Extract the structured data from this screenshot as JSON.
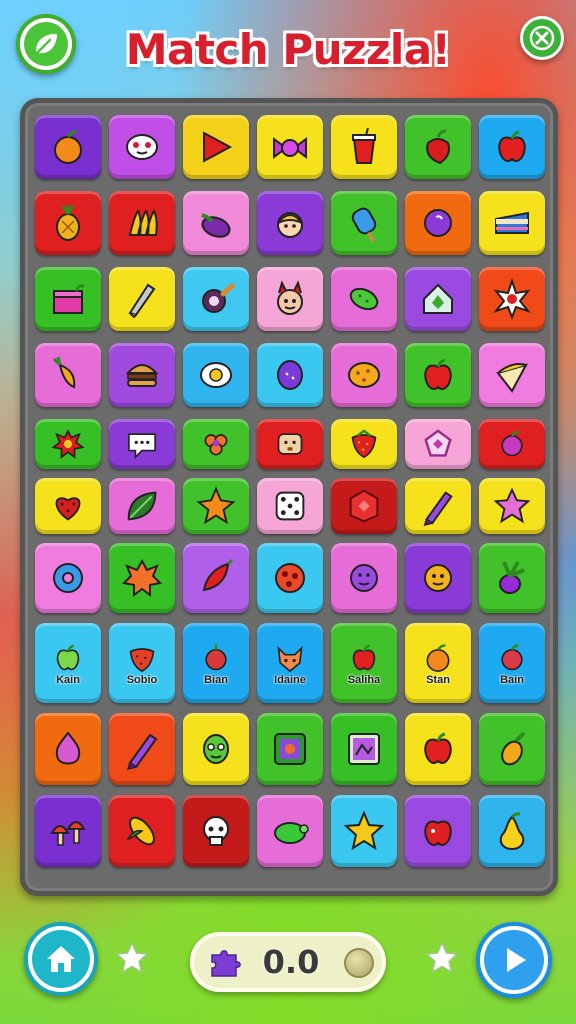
{
  "app": {
    "title": "Match Puzzla!"
  },
  "header": {
    "logo_icon": "leaf-icon",
    "close_icon": "close-icon"
  },
  "board": {
    "rows": [
      [
        {
          "color": "#7a2fd0",
          "icon": "orange-fruit"
        },
        {
          "color": "#c24ee8",
          "icon": "mushroom-face"
        },
        {
          "color": "#f4d21a",
          "icon": "red-arrow"
        },
        {
          "color": "#f6e21c",
          "icon": "candy-wrapper"
        },
        {
          "color": "#f6e21c",
          "icon": "red-drink-cup"
        },
        {
          "color": "#42c22a",
          "icon": "red-pepper"
        },
        {
          "color": "#1ea9f0",
          "icon": "red-apple"
        }
      ],
      [
        {
          "color": "#e02020",
          "icon": "pineapple"
        },
        {
          "color": "#e02020",
          "icon": "banana-bunch"
        },
        {
          "color": "#f08ad8",
          "icon": "eggplant"
        },
        {
          "color": "#8a3ad6",
          "icon": "blonde-face"
        },
        {
          "color": "#42c22a",
          "icon": "ice-pop"
        },
        {
          "color": "#f26a10",
          "icon": "purple-plum"
        },
        {
          "color": "#f6e21c",
          "icon": "cake-slice"
        }
      ],
      [
        {
          "color": "#36c026",
          "icon": "gift-box"
        },
        {
          "color": "#f6e21c",
          "icon": "paint-brush"
        },
        {
          "color": "#3fc8f0",
          "icon": "frying-pan"
        },
        {
          "color": "#f6a6d6",
          "icon": "devil-face"
        },
        {
          "color": "#e66cd8",
          "icon": "green-pickle"
        },
        {
          "color": "#9a4ae0",
          "icon": "green-house"
        },
        {
          "color": "#f04a18",
          "icon": "star-burst"
        }
      ],
      [
        {
          "color": "#e66cd8",
          "icon": "carrot"
        },
        {
          "color": "#a04ae0",
          "icon": "burger"
        },
        {
          "color": "#2fb4ee",
          "icon": "fried-egg"
        },
        {
          "color": "#3ac8f0",
          "icon": "purple-bean"
        },
        {
          "color": "#e66cd8",
          "icon": "orange-potato"
        },
        {
          "color": "#42c22a",
          "icon": "red-apple"
        },
        {
          "color": "#f07ce0",
          "icon": "ice-cream-cone"
        }
      ],
      [
        {
          "color": "#36c026",
          "icon": "red-splat"
        },
        {
          "color": "#8a3ad6",
          "icon": "chat-bubble"
        },
        {
          "color": "#42c22a",
          "icon": "orange-flower"
        },
        {
          "color": "#e02020",
          "icon": "toast-face"
        },
        {
          "color": "#f6e21c",
          "icon": "strawberry"
        },
        {
          "color": "#f6a6d6",
          "icon": "pentagon-gem"
        },
        {
          "color": "#e02020",
          "icon": "purple-berry"
        }
      ],
      [
        {
          "color": "#f6e21c",
          "icon": "heart-berry"
        },
        {
          "color": "#e66cd8",
          "icon": "green-leaf"
        },
        {
          "color": "#42c22a",
          "icon": "orange-star"
        },
        {
          "color": "#f6a6d6",
          "icon": "dice"
        },
        {
          "color": "#c41a1a",
          "icon": "red-badge"
        },
        {
          "color": "#f6e21c",
          "icon": "purple-crayon"
        },
        {
          "color": "#f6e21c",
          "icon": "pink-star"
        }
      ],
      [
        {
          "color": "#f07ce0",
          "icon": "blue-donut"
        },
        {
          "color": "#36c026",
          "icon": "orange-splat"
        },
        {
          "color": "#b060e8",
          "icon": "chili-pepper"
        },
        {
          "color": "#3ac8f0",
          "icon": "red-pizza"
        },
        {
          "color": "#e66cd8",
          "icon": "purple-button"
        },
        {
          "color": "#8a3ad6",
          "icon": "orange-face"
        },
        {
          "color": "#42c22a",
          "icon": "beet-sprout"
        }
      ],
      [
        {
          "color": "#3ac8f0",
          "icon": "green-apple",
          "label": "Kain"
        },
        {
          "color": "#3ac8f0",
          "icon": "red-strawberry",
          "label": "Sobio"
        },
        {
          "color": "#1ea9f0",
          "icon": "red-onion",
          "label": "Bian"
        },
        {
          "color": "#1ea9f0",
          "icon": "fox-face",
          "label": "Idaine"
        },
        {
          "color": "#42c22a",
          "icon": "red-apple",
          "label": "Saliha"
        },
        {
          "color": "#f6e21c",
          "icon": "orange-fruit",
          "label": "Stan"
        },
        {
          "color": "#1ea9f0",
          "icon": "red-plum",
          "label": "Bain"
        }
      ],
      [
        {
          "color": "#f26a10",
          "icon": "purple-onion"
        },
        {
          "color": "#f04a18",
          "icon": "purple-crayon"
        },
        {
          "color": "#f6e21c",
          "icon": "green-alien"
        },
        {
          "color": "#42c22a",
          "icon": "flower-frame"
        },
        {
          "color": "#36c026",
          "icon": "photo-frame"
        },
        {
          "color": "#f6e21c",
          "icon": "red-apple"
        },
        {
          "color": "#42c22a",
          "icon": "orange-pineapple"
        }
      ],
      [
        {
          "color": "#7a2fd0",
          "icon": "mushroom-cluster"
        },
        {
          "color": "#e02020",
          "icon": "corn-cob"
        },
        {
          "color": "#c41a1a",
          "icon": "white-skull"
        },
        {
          "color": "#e66cd8",
          "icon": "green-turtle"
        },
        {
          "color": "#3ac8f0",
          "icon": "gold-star"
        },
        {
          "color": "#9a4ae0",
          "icon": "red-cherry-apple"
        },
        {
          "color": "#2fb4ee",
          "icon": "yellow-pear"
        }
      ]
    ]
  },
  "footer": {
    "home_icon": "home-icon",
    "play_icon": "play-icon",
    "score_icon": "puzzle-piece-icon",
    "score": "0.0"
  }
}
